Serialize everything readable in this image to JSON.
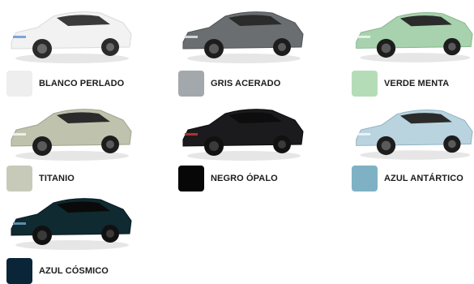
{
  "colors": [
    {
      "name": "BLANCO PERLADO",
      "swatch": "#eeeeee",
      "body": "#f2f2f2",
      "shade": "#d9d9d9"
    },
    {
      "name": "GRIS ACERADO",
      "swatch": "#a3a8ad",
      "body": "#6b6e71",
      "shade": "#4f5254"
    },
    {
      "name": "VERDE MENTA",
      "swatch": "#b4ddb7",
      "body": "#a7d2ad",
      "shade": "#86b58d"
    },
    {
      "name": "TITANIO",
      "swatch": "#c8cab9",
      "body": "#bfc2ad",
      "shade": "#9ea28d"
    },
    {
      "name": "NEGRO ÓPALO",
      "swatch": "#070707",
      "body": "#1b1b1d",
      "shade": "#0b0b0c"
    },
    {
      "name": "AZUL ANTÁRTICO",
      "swatch": "#7fb1c5",
      "body": "#b9d3df",
      "shade": "#8fb2c3"
    },
    {
      "name": "AZUL CÓSMICO",
      "swatch": "#0a2438",
      "body": "#0f2a30",
      "shade": "#081a1f"
    }
  ]
}
